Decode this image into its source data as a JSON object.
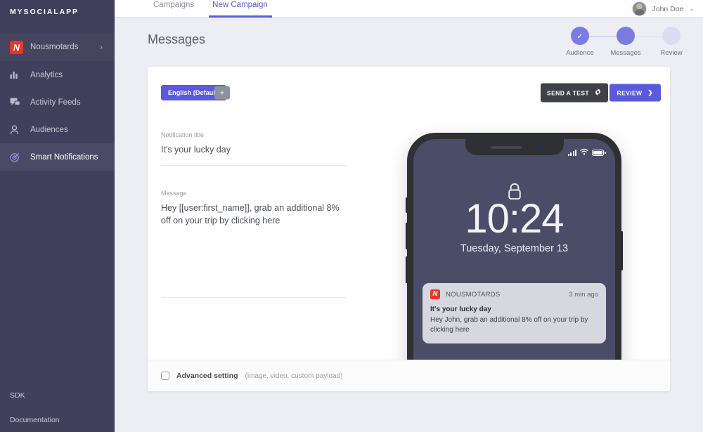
{
  "brand": {
    "name": "MYSOCIALAPP"
  },
  "sidebar": {
    "app": {
      "label": "Nousmotards",
      "logo_letter": "N",
      "chevron": "›"
    },
    "items": [
      {
        "label": "Analytics",
        "icon": "bar-chart-icon"
      },
      {
        "label": "Activity Feeds",
        "icon": "chat-bubbles-icon"
      },
      {
        "label": "Audiences",
        "icon": "person-icon"
      },
      {
        "label": "Smart Notifications",
        "icon": "target-icon"
      }
    ],
    "bottom": [
      {
        "label": "SDK"
      },
      {
        "label": "Documentation"
      }
    ]
  },
  "topbar": {
    "tabs": [
      {
        "label": "Campaigns",
        "active": false
      },
      {
        "label": "New Campaign",
        "active": true
      }
    ],
    "user": {
      "name": "John Doe",
      "chevron": "⌄"
    }
  },
  "page": {
    "title": "Messages"
  },
  "stepper": {
    "steps": [
      {
        "label": "Audience",
        "state": "done",
        "glyph": "✓"
      },
      {
        "label": "Messages",
        "state": "current",
        "glyph": ""
      },
      {
        "label": "Review",
        "state": "todo",
        "glyph": ""
      }
    ]
  },
  "toolbar": {
    "language_pill": "English (Default)",
    "add_language": "+",
    "send_test": "SEND A TEST",
    "review": "REVIEW",
    "review_arrow": "❯"
  },
  "form": {
    "title_label": "Notification title",
    "title_value": "It's your lucky day",
    "message_label": "Message",
    "message_value": "Hey [[user:first_name]], grab an additional 8% off on your trip by clicking here"
  },
  "phone": {
    "time": "10:24",
    "date": "Tuesday, September 13",
    "status_icons": [
      "signal-bars-icon",
      "wifi-icon",
      "battery-icon"
    ],
    "notification": {
      "app_logo_letter": "N",
      "app_name": "NOUSMOTARDS",
      "time_ago": "3 min ago",
      "title": "It's your lucky day",
      "body": "Hey John, grab an additional 8% off on your trip by clicking here"
    }
  },
  "footer": {
    "advanced_label": "Advanced setting",
    "advanced_hint": "(image, video, custom payload)"
  },
  "colors": {
    "accent": "#5a5ae0",
    "sidebar": "#40405c",
    "brand_red": "#e8342a",
    "phone_screen": "#4b4c68",
    "dark_button": "#3f4147"
  }
}
